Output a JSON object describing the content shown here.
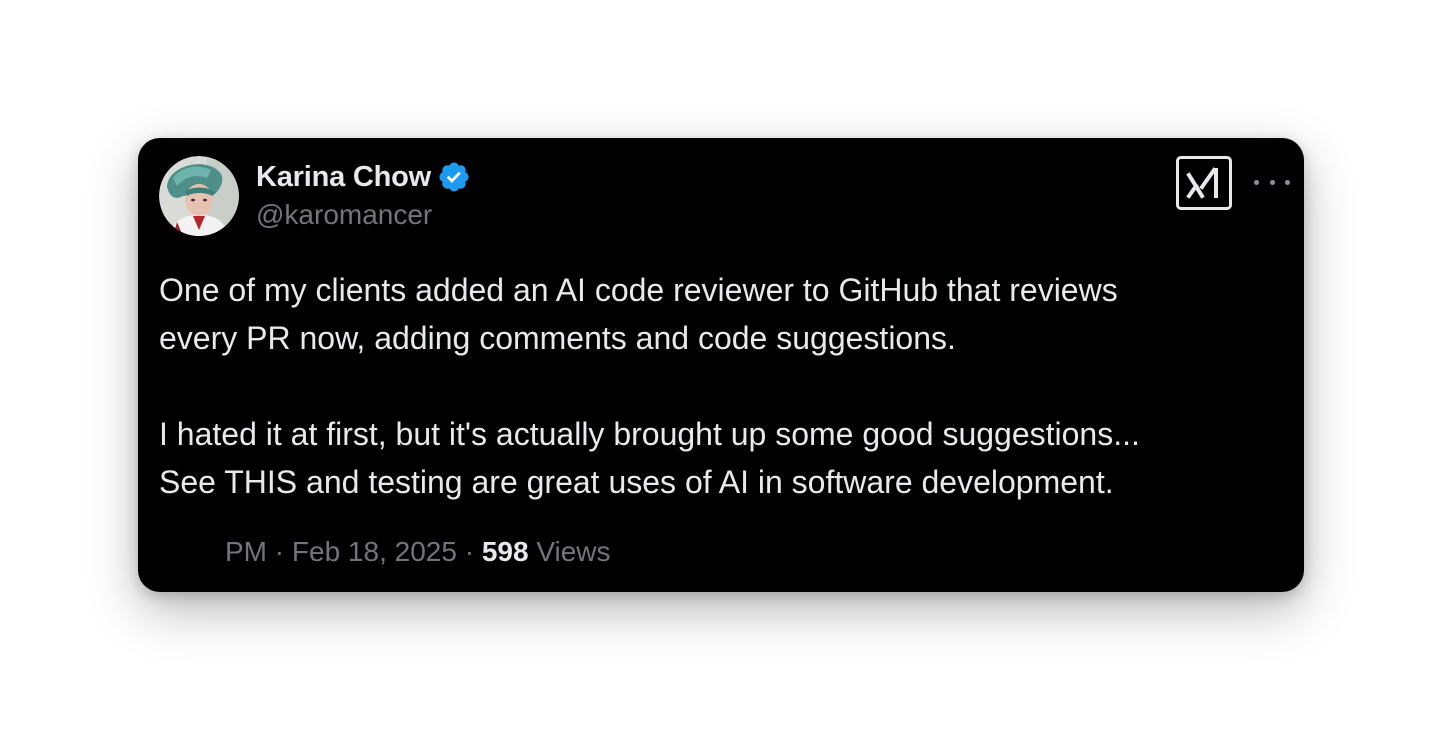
{
  "tweet": {
    "display_name": "Karina Chow",
    "handle": "@karomancer",
    "verified": true,
    "body": {
      "paragraph1_line1": "One of my clients added an AI code reviewer to GitHub that reviews",
      "paragraph1_line2": "every PR now, adding comments and code suggestions.",
      "paragraph2_line1": "I hated it at first, but it's actually brought up some good suggestions...",
      "paragraph2_line2": "See THIS and testing are great uses of AI in software development."
    },
    "meta": {
      "time": "PM",
      "separator": "·",
      "date": "Feb 18, 2025",
      "views_count": "598",
      "views_label": "Views"
    }
  },
  "icons": {
    "avatar": "profile-photo",
    "verified": "verified-badge-icon",
    "logo": "x-ai-logo-icon",
    "more": "more-options-icon"
  },
  "colors": {
    "card_background": "#000000",
    "text_primary": "#e7e9ea",
    "text_secondary": "#71767b",
    "verified_blue": "#1d9bf0"
  }
}
